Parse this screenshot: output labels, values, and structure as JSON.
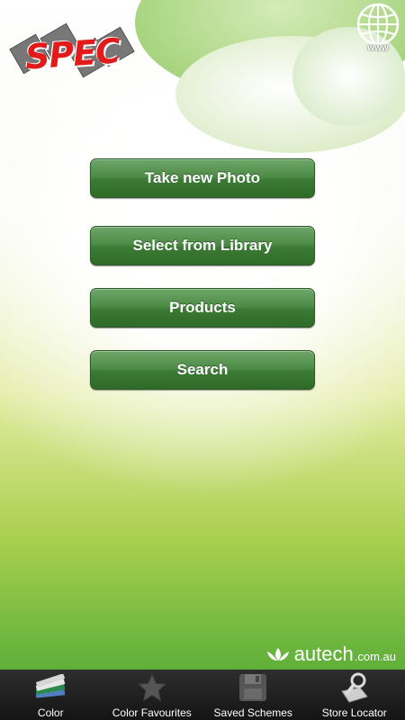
{
  "brand": {
    "logo_text": "SPEC"
  },
  "web_link": {
    "label": "www"
  },
  "menu": {
    "take_photo": "Take new Photo",
    "select_library": "Select from Library",
    "products": "Products",
    "search": "Search"
  },
  "footer_brand": {
    "name": "autech",
    "domain": ".com.au"
  },
  "tabs": [
    {
      "label": "Color",
      "icon": "color-swatches-icon"
    },
    {
      "label": "Color Favourites",
      "icon": "star-icon"
    },
    {
      "label": "Saved Schemes",
      "icon": "floppy-disk-icon"
    },
    {
      "label": "Store Locator",
      "icon": "map-search-icon"
    }
  ],
  "colors": {
    "button_green": "#3b7a34",
    "logo_red": "#e21a1a",
    "tabbar": "#1e1e1e",
    "background_green": "#62b13b"
  }
}
